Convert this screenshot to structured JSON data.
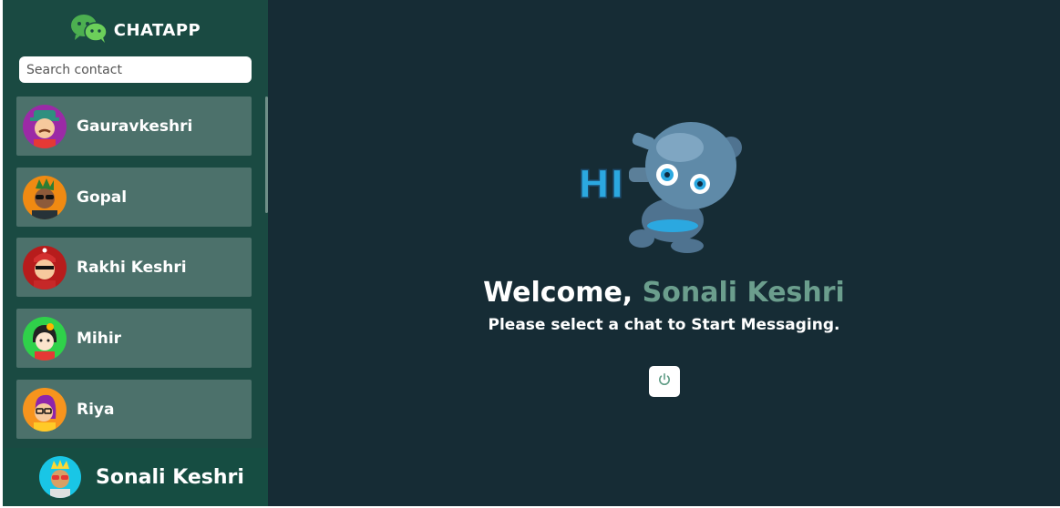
{
  "brand": {
    "title": "CHATAPP"
  },
  "search": {
    "placeholder": "Search contact"
  },
  "contacts": [
    {
      "name": "Gauravkeshri",
      "avatar_bg": "#9b2aa6"
    },
    {
      "name": "Gopal",
      "avatar_bg": "#f08a12"
    },
    {
      "name": "Rakhi Keshri",
      "avatar_bg": "#b71c1c"
    },
    {
      "name": "Mihir",
      "avatar_bg": "#2fd14a"
    },
    {
      "name": "Riya",
      "avatar_bg": "#f7941d"
    }
  ],
  "current_user": {
    "name": "Sonali Keshri",
    "avatar_bg": "#19c6e6"
  },
  "main": {
    "welcome_prefix": "Welcome, ",
    "welcome_name": "Sonali Keshri",
    "subtitle": "Please select a chat to Start Messaging.",
    "robot_text": "HI"
  },
  "colors": {
    "sidebar": "#1a4a42",
    "contact_card": "#4c716b",
    "main_bg": "#162c35",
    "accent_name": "#6b9e8d"
  },
  "icons": {
    "brand": "wechat-icon",
    "logout": "power-icon"
  }
}
